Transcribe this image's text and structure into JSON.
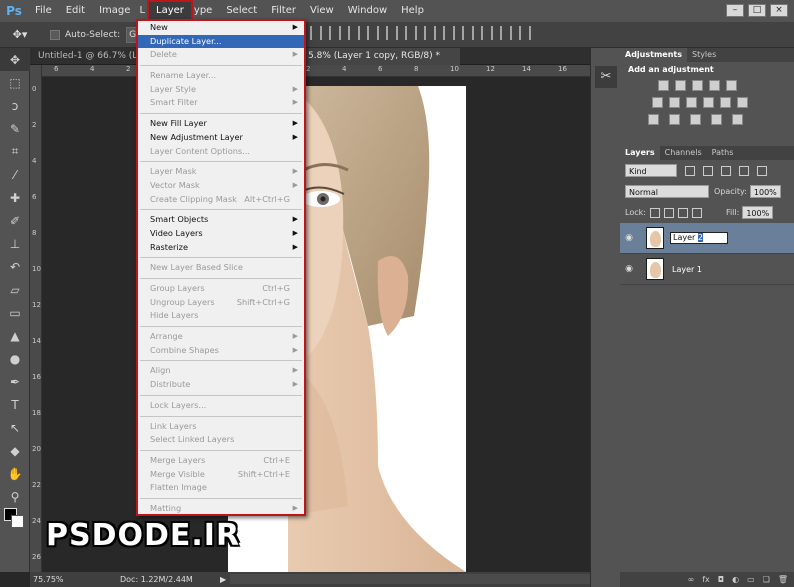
{
  "app": {
    "logo": "Ps"
  },
  "menubar": {
    "items": [
      "File",
      "Edit",
      "Image",
      "L",
      "Layer",
      "ype",
      "Select",
      "Filter",
      "View",
      "Window",
      "Help"
    ]
  },
  "window_buttons": [
    "–",
    "□",
    "×"
  ],
  "options_bar": {
    "auto_select_label": "Auto-Select:",
    "auto_select_value": "Gr"
  },
  "document": {
    "tab_inactive": "Untitled-1 @ 66.7% (L",
    "tab_active": "5.8% (Layer 1 copy, RGB/8) *",
    "ruler_top": [
      "6",
      "4",
      "2",
      "0",
      "2",
      "4",
      "6",
      "8",
      "10",
      "12",
      "14",
      "16",
      "18"
    ],
    "ruler_left": [
      "0",
      "2",
      "4",
      "6",
      "8",
      "10",
      "12",
      "14",
      "16",
      "18",
      "20",
      "22",
      "24",
      "26"
    ]
  },
  "status_bar": {
    "zoom": "75.75%",
    "doc": "Doc: 1.22M/2.44M"
  },
  "watermark": "PSDODE.IR",
  "layer_menu": {
    "items": [
      {
        "label": "New",
        "sub": true
      },
      {
        "label": "Duplicate Layer...",
        "highlight": true
      },
      {
        "label": "Delete",
        "disabled": true,
        "sub": true
      },
      {
        "sep": true
      },
      {
        "label": "Rename Layer...",
        "disabled": true
      },
      {
        "label": "Layer Style",
        "disabled": true,
        "sub": true
      },
      {
        "label": "Smart Filter",
        "disabled": true,
        "sub": true
      },
      {
        "sep": true
      },
      {
        "label": "New Fill Layer",
        "sub": true
      },
      {
        "label": "New Adjustment Layer",
        "sub": true
      },
      {
        "label": "Layer Content Options...",
        "disabled": true
      },
      {
        "sep": true
      },
      {
        "label": "Layer Mask",
        "disabled": true,
        "sub": true
      },
      {
        "label": "Vector Mask",
        "disabled": true,
        "sub": true
      },
      {
        "label": "Create Clipping Mask",
        "disabled": true,
        "shortcut": "Alt+Ctrl+G"
      },
      {
        "sep": true
      },
      {
        "label": "Smart Objects",
        "sub": true
      },
      {
        "label": "Video Layers",
        "sub": true
      },
      {
        "label": "Rasterize",
        "sub": true
      },
      {
        "sep": true
      },
      {
        "label": "New Layer Based Slice",
        "disabled": true
      },
      {
        "sep": true
      },
      {
        "label": "Group Layers",
        "disabled": true,
        "shortcut": "Ctrl+G"
      },
      {
        "label": "Ungroup Layers",
        "disabled": true,
        "shortcut": "Shift+Ctrl+G"
      },
      {
        "label": "Hide Layers",
        "disabled": true
      },
      {
        "sep": true
      },
      {
        "label": "Arrange",
        "disabled": true,
        "sub": true
      },
      {
        "label": "Combine Shapes",
        "disabled": true,
        "sub": true
      },
      {
        "sep": true
      },
      {
        "label": "Align",
        "disabled": true,
        "sub": true
      },
      {
        "label": "Distribute",
        "disabled": true,
        "sub": true
      },
      {
        "sep": true
      },
      {
        "label": "Lock Layers...",
        "disabled": true
      },
      {
        "sep": true
      },
      {
        "label": "Link Layers",
        "disabled": true
      },
      {
        "label": "Select Linked Layers",
        "disabled": true
      },
      {
        "sep": true
      },
      {
        "label": "Merge Layers",
        "disabled": true,
        "shortcut": "Ctrl+E"
      },
      {
        "label": "Merge Visible",
        "disabled": true,
        "shortcut": "Shift+Ctrl+E"
      },
      {
        "label": "Flatten Image",
        "disabled": true
      },
      {
        "sep": true
      },
      {
        "label": "Matting",
        "disabled": true,
        "sub": true
      }
    ]
  },
  "adjustments_panel": {
    "tabs": [
      "Adjustments",
      "Styles"
    ],
    "title": "Add an adjustment"
  },
  "layers_panel": {
    "tabs": [
      "Layers",
      "Channels",
      "Paths"
    ],
    "kind_label": "Kind",
    "blend_mode": "Normal",
    "opacity_label": "Opacity:",
    "opacity_value": "100%",
    "lock_label": "Lock:",
    "fill_label": "Fill:",
    "fill_value": "100%",
    "layers": [
      {
        "name_prefix": "Layer ",
        "name_selected": "2",
        "editing": true,
        "selected": true
      },
      {
        "name": "Layer 1"
      }
    ],
    "bottom_icons": [
      "link-icon",
      "fx-icon",
      "mask-icon",
      "adjustment-icon",
      "folder-icon",
      "new-layer-icon",
      "trash-icon"
    ]
  },
  "colors": {
    "menu_border": "#c0141b",
    "highlight": "#3367b8",
    "panel": "#535353",
    "canvas": "#282828"
  }
}
